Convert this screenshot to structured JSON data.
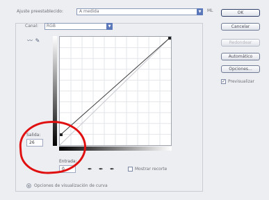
{
  "preset": {
    "label": "Ajuste preestablecido:",
    "value": "A medida",
    "menu_icon": "menu-icon",
    "menu_text": "ML"
  },
  "channel": {
    "label": "Canal:",
    "value": "RGB"
  },
  "tools": [
    "curve-point-icon",
    "pencil-icon"
  ],
  "salida": {
    "label": "Salida:",
    "value": "26"
  },
  "entrada": {
    "label": "Entrada:",
    "value": "0"
  },
  "eyedroppers": [
    "black-eyedropper-icon",
    "gray-eyedropper-icon",
    "white-eyedropper-icon"
  ],
  "clipping": {
    "label": "Mostrar recorte",
    "checked": false
  },
  "curve_options": {
    "label": "Opciones de visualización de curva"
  },
  "buttons": {
    "ok": "OK",
    "cancel": "Cancelar",
    "smooth": "Redondear",
    "auto": "Automático",
    "options": "Opciones..."
  },
  "preview": {
    "label": "Previsualizar",
    "checked": true
  },
  "colors": {
    "highlight_circle": "#e01010",
    "accent": "#5b78ba"
  }
}
